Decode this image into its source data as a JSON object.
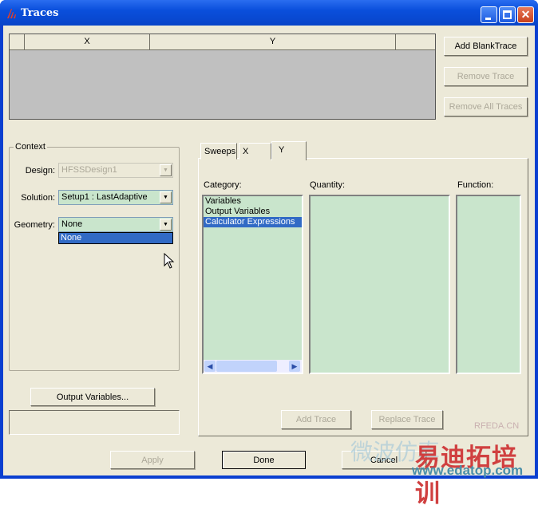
{
  "window": {
    "title": "Traces"
  },
  "traces_table": {
    "columns": [
      "X",
      "Y"
    ]
  },
  "trace_buttons": {
    "add_blank": "Add BlankTrace",
    "remove": "Remove Trace",
    "remove_all": "Remove All Traces"
  },
  "context": {
    "legend": "Context",
    "design_label": "Design:",
    "design_value": "HFSSDesign1",
    "solution_label": "Solution:",
    "solution_value": "Setup1 : LastAdaptive",
    "geometry_label": "Geometry:",
    "geometry_value": "None",
    "geometry_options": [
      "None"
    ]
  },
  "output_variables_button": "Output Variables...",
  "tabs": [
    "Sweeps",
    "X",
    "Y"
  ],
  "selected_tab": "Y",
  "y_panel": {
    "category_label": "Category:",
    "quantity_label": "Quantity:",
    "function_label": "Function:",
    "categories": [
      "Variables",
      "Output Variables",
      "Calculator Expressions"
    ],
    "selected_category": "Calculator Expressions",
    "add_trace": "Add Trace",
    "replace_trace": "Replace Trace"
  },
  "footer": {
    "apply": "Apply",
    "done": "Done",
    "cancel": "Cancel"
  },
  "watermark": {
    "site": "RFEDA.CN",
    "brand": "易迪拓培训",
    "url": "www.edatop.com",
    "cn": "微波仿真"
  }
}
